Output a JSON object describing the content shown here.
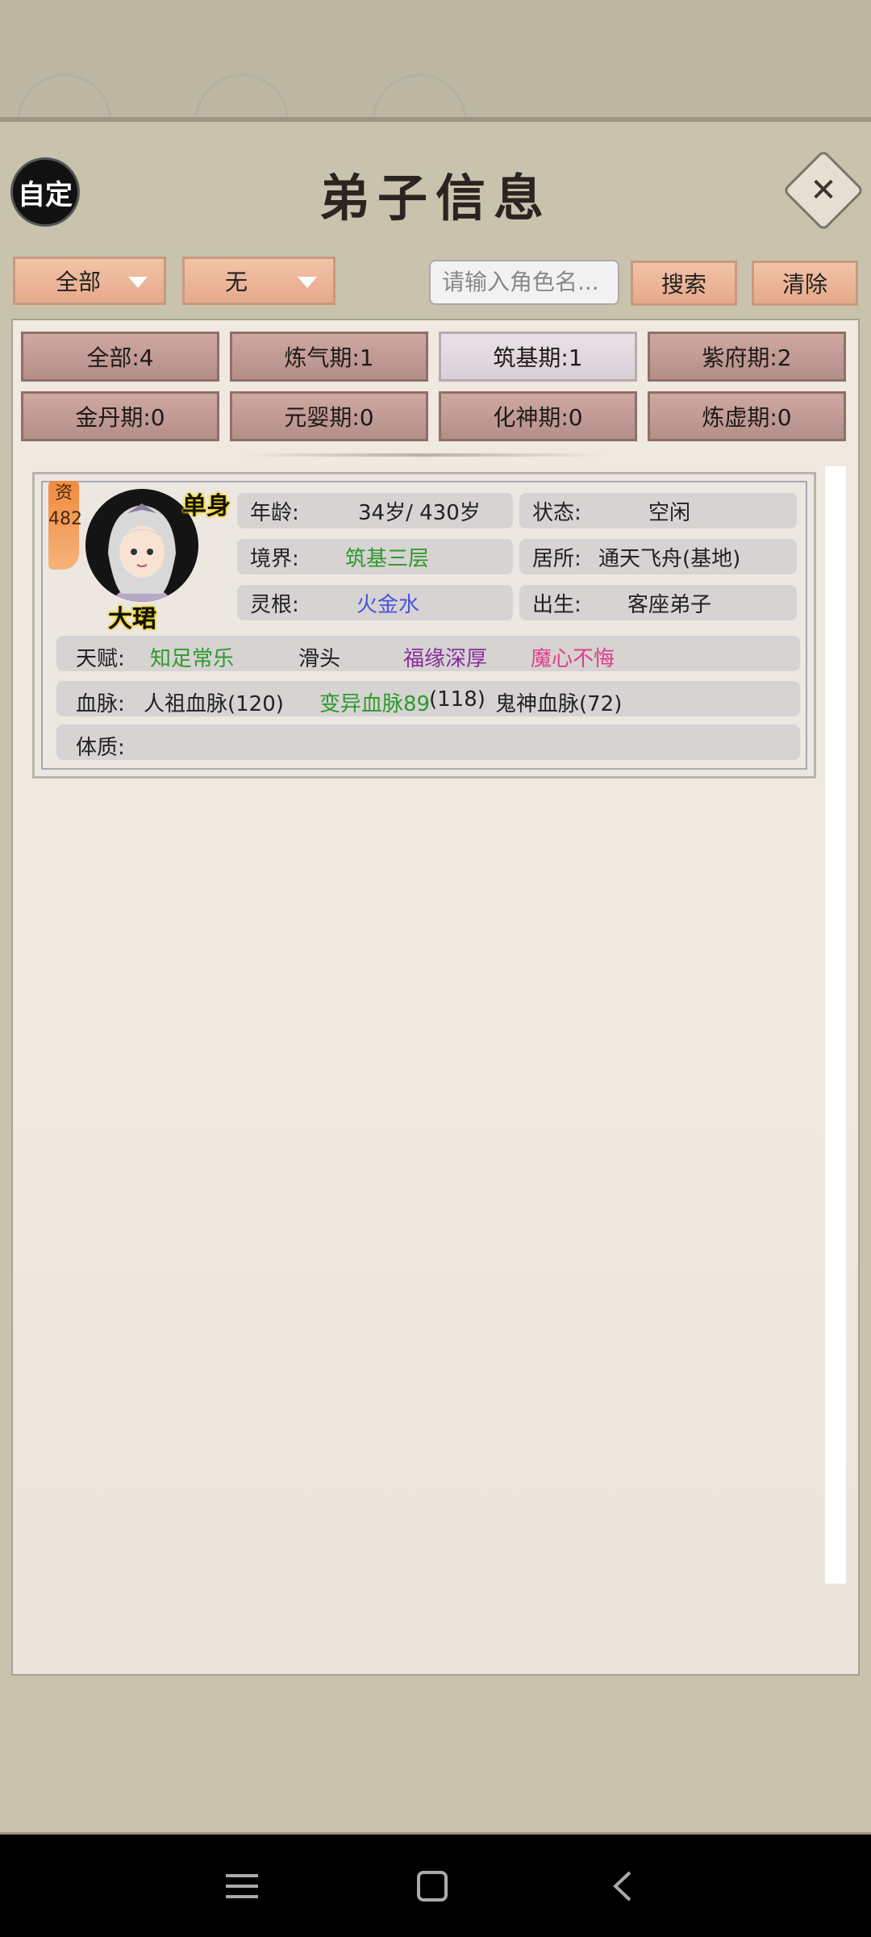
{
  "header": {
    "title": "弟子信息",
    "custom_label": "自定"
  },
  "filters": {
    "dropdown1": "全部",
    "dropdown2": "无",
    "search_placeholder": "请输入角色名...",
    "search_label": "搜索",
    "clear_label": "清除"
  },
  "stages": [
    {
      "label": "全部:4"
    },
    {
      "label": "炼气期:1"
    },
    {
      "label": "筑基期:1"
    },
    {
      "label": "紫府期:2"
    },
    {
      "label": "金丹期:0"
    },
    {
      "label": "元婴期:0"
    },
    {
      "label": "化神期:0"
    },
    {
      "label": "炼虚期:0"
    }
  ],
  "disciple": {
    "aptitude_label": "资",
    "aptitude_value": "482",
    "single_tag": "单身",
    "name": "大珺",
    "age_label": "年龄:",
    "age_value": "34岁/ 430岁",
    "status_label": "状态:",
    "status_value": "空闲",
    "realm_label": "境界:",
    "realm_value": "筑基三层",
    "residence_label": "居所:",
    "residence_value": "通天飞舟(基地)",
    "root_label": "灵根:",
    "root_value": "火金水",
    "birth_label": "出生:",
    "birth_value": "客座弟子",
    "talent_label": "天赋:",
    "talents": [
      "知足常乐",
      "滑头",
      "福缘深厚",
      "魔心不悔"
    ],
    "bloodline_label": "血脉:",
    "bloodlines": [
      "人祖血脉(120)",
      "变异血脉89",
      "(118)",
      "鬼神血脉(72)"
    ],
    "physique_label": "体质:"
  },
  "colors": {
    "talent_green": "#2e9a2e",
    "talent_purple": "#8a2d9c",
    "talent_pink": "#e0408a",
    "root_blue": "#4b52e0"
  },
  "navbar": {
    "icons": [
      "menu-icon",
      "home-square-icon",
      "back-chevron-icon"
    ]
  }
}
